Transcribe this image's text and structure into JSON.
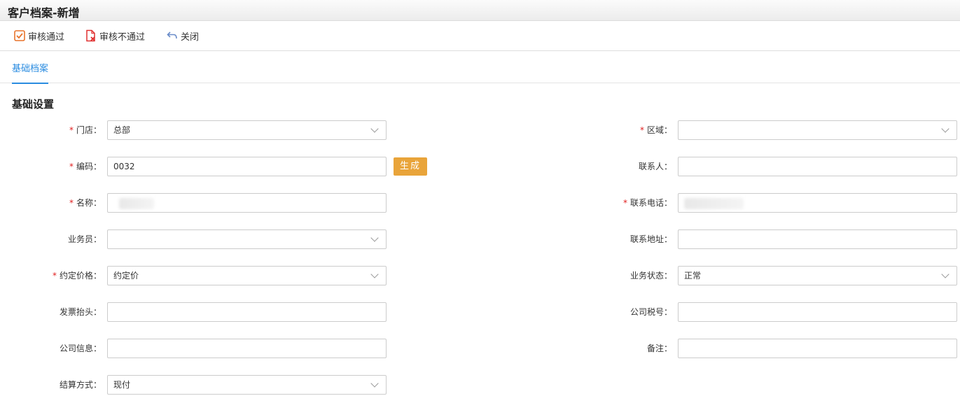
{
  "window": {
    "title": "客户档案-新增"
  },
  "toolbar": {
    "approve_label": "审核通过",
    "reject_label": "审核不通过",
    "close_label": "关闭"
  },
  "tabs": [
    {
      "label": "基础档案",
      "active": true
    }
  ],
  "section": {
    "title": "基础设置"
  },
  "form": {
    "store": {
      "label": "门店",
      "value": "总部",
      "required": true
    },
    "code": {
      "label": "编码",
      "value": "0032",
      "required": true
    },
    "generate_button": "生成",
    "name": {
      "label": "名称",
      "value": "",
      "required": true,
      "redacted": true
    },
    "salesperson": {
      "label": "业务员",
      "value": ""
    },
    "price_type": {
      "label": "约定价格",
      "value": "约定价",
      "required": true
    },
    "invoice_title": {
      "label": "发票抬头",
      "value": ""
    },
    "company_info": {
      "label": "公司信息",
      "value": ""
    },
    "settlement": {
      "label": "结算方式",
      "value": "现付"
    },
    "region": {
      "label": "区域",
      "value": "",
      "required": true
    },
    "contact": {
      "label": "联系人",
      "value": ""
    },
    "phone": {
      "label": "联系电话",
      "value": "",
      "required": true,
      "redacted": true
    },
    "address": {
      "label": "联系地址",
      "value": ""
    },
    "status": {
      "label": "业务状态",
      "value": "正常"
    },
    "tax_no": {
      "label": "公司税号",
      "value": ""
    },
    "remark": {
      "label": "备注",
      "value": ""
    }
  },
  "colors": {
    "accent": "#2b8ce0",
    "generate_button": "#e9a43a",
    "required_mark": "#e02020",
    "approve_icon": "#e8742c",
    "reject_icon": "#e03030",
    "close_icon": "#6a8cc9"
  }
}
